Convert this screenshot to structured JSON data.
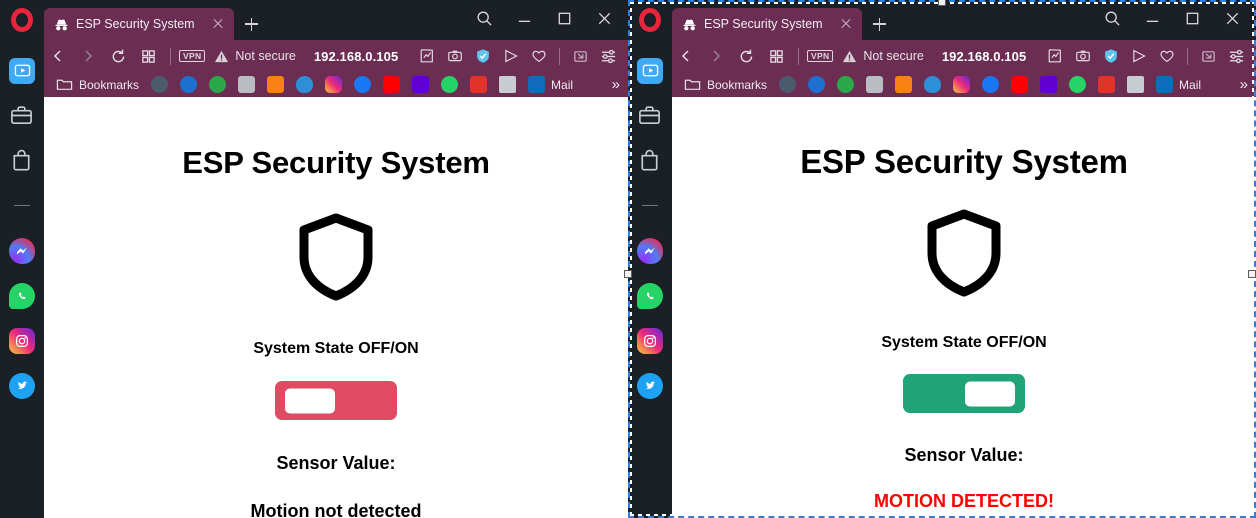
{
  "browser": {
    "app_logo": "opera-logo",
    "tab": {
      "favicon": "incognito-hat-icon",
      "title": "ESP Security System",
      "close_label": "close-tab"
    },
    "new_tab_label": "+",
    "window_controls": [
      {
        "name": "search-icon",
        "glyph": "search"
      },
      {
        "name": "minimize-icon",
        "glyph": "minimize"
      },
      {
        "name": "maximize-icon",
        "glyph": "maximize"
      },
      {
        "name": "close-icon",
        "glyph": "close"
      }
    ],
    "navbar": {
      "back_label": "Back",
      "forward_label": "Forward",
      "reload_label": "Reload",
      "tabs_overview_label": "Tab islands",
      "vpn_badge": "VPN",
      "security_status": "Not secure",
      "url": "192.168.0.105",
      "right_icons": [
        {
          "name": "pin-page-icon"
        },
        {
          "name": "snapshot-camera-icon"
        },
        {
          "name": "adblock-shield-icon"
        },
        {
          "name": "send-flow-icon"
        },
        {
          "name": "heart-favorite-icon"
        },
        {
          "name": "cast-screen-icon"
        },
        {
          "name": "easy-setup-sliders-icon"
        }
      ]
    },
    "bookmarks_bar": {
      "folder_icon": "folder-icon",
      "folder_label": "Bookmarks",
      "items": [
        {
          "name": "bookmark-globe",
          "color": "#4a5b6e"
        },
        {
          "name": "bookmark-cisco-any",
          "color": "#1f6fd0"
        },
        {
          "name": "bookmark-green-app",
          "color": "#2aa84a"
        },
        {
          "name": "bookmark-grey-app",
          "color": "#b9bcc2"
        },
        {
          "name": "bookmark-moodle",
          "color": "#f98012"
        },
        {
          "name": "bookmark-onedrive",
          "color": "#2d8fd8"
        },
        {
          "name": "bookmark-instagram",
          "color": "#e1306c"
        },
        {
          "name": "bookmark-facebook",
          "color": "#1877f2"
        },
        {
          "name": "bookmark-youtube",
          "color": "#ff0000"
        },
        {
          "name": "bookmark-yahoo",
          "color": "#6001d2"
        },
        {
          "name": "bookmark-whatsapp",
          "color": "#25d366"
        },
        {
          "name": "bookmark-prezi",
          "color": "#e2332a"
        },
        {
          "name": "bookmark-cisco",
          "color": "#c8cdd4"
        },
        {
          "name": "bookmark-outlook",
          "color": "#0f6cbd"
        }
      ],
      "mail_label": "Mail",
      "overflow_label": "»"
    },
    "sidebar": {
      "items": [
        {
          "name": "sidebar-player",
          "color": "#3fa9f5"
        },
        {
          "name": "sidebar-workspace",
          "color": "#c9cdd4"
        },
        {
          "name": "sidebar-shopping",
          "color": "#c9cdd4"
        },
        {
          "name": "sidebar-divider",
          "color": "#6f757f"
        },
        {
          "name": "sidebar-messenger",
          "color": "#a334fa"
        },
        {
          "name": "sidebar-whatsapp",
          "color": "#25d366"
        },
        {
          "name": "sidebar-instagram",
          "color": "#e1306c"
        },
        {
          "name": "sidebar-twitter",
          "color": "#1da1f2"
        }
      ]
    }
  },
  "colors": {
    "chrome_maroon": "#6b2d52",
    "chrome_dark": "#1b1f26",
    "toggle_off": "#e04a63",
    "toggle_on": "#1fa377",
    "alert_red": "#fe0000",
    "selection_blue": "#2a7fe0"
  },
  "left_page": {
    "title": "ESP Security System",
    "shield_icon": "shield-outline-icon",
    "state_label": "System State OFF/ON",
    "toggle": {
      "name": "system-state-toggle",
      "state": "off",
      "color": "#e04a63",
      "knob_side": "left"
    },
    "sensor_label": "Sensor Value:",
    "sensor_value": "Motion not detected",
    "sensor_value_color": "#000000"
  },
  "right_page": {
    "title": "ESP Security System",
    "shield_icon": "shield-outline-icon",
    "state_label": "System State OFF/ON",
    "toggle": {
      "name": "system-state-toggle",
      "state": "on",
      "color": "#1fa377",
      "knob_side": "right"
    },
    "sensor_label": "Sensor Value:",
    "sensor_value": "MOTION DETECTED!",
    "sensor_value_color": "#fe0000"
  }
}
